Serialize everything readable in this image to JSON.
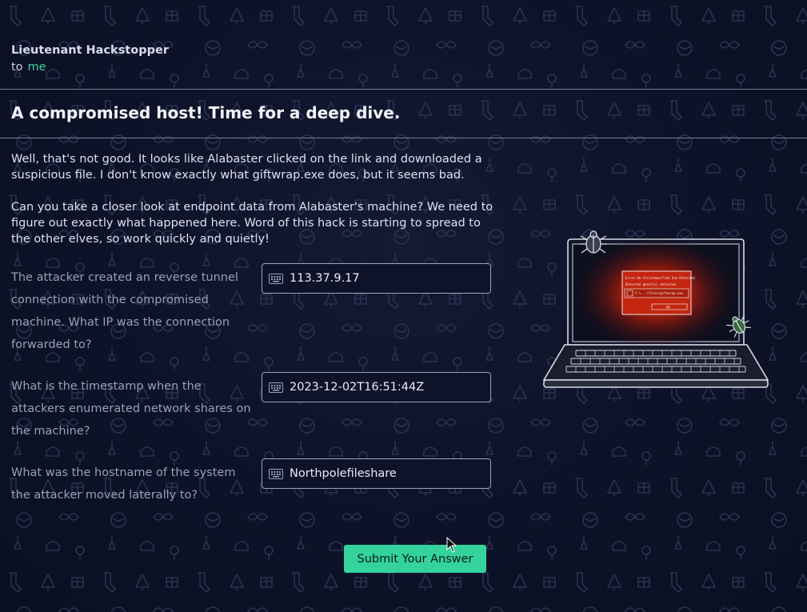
{
  "message": {
    "sender": "Lieutenant Hackstopper",
    "recipient_prefix": "to",
    "recipient": "me",
    "subject": "A compromised host! Time for a deep dive.",
    "paragraph_1": "Well, that's not good. It looks like Alabaster clicked on the link and downloaded a suspicious file. I don't know exactly what giftwrap.exe does, but it seems bad.",
    "paragraph_2": "Can you take a closer look at endpoint data from Alabaster's machine? We need to figure out exactly what happened here. Word of this hack is starting to spread to the other elves, so work quickly and quietly!"
  },
  "questions": [
    {
      "text": "The attacker created an reverse tunnel connection with the compromised machine. What IP was the connection forwarded to?",
      "answer": "113.37.9.17"
    },
    {
      "text": "What is the timestamp when the attackers enumerated network shares on the machine?",
      "answer": "2023-12-02T16:51:44Z"
    },
    {
      "text": "What was the hostname of the system the attacker moved laterally to?",
      "answer": "Northpolefileshare"
    }
  ],
  "submit_label": "Submit Your Answer",
  "illustration": {
    "dialog_line_1": "Error:Un-Christmasified Exe Detected",
    "dialog_line_2": "Detected ghost(s) detected",
    "dialog_path": "C:\\...\\files\\giftwrap.exe",
    "dialog_ok": "OK"
  },
  "colors": {
    "accent": "#34d39e",
    "background": "#0d1228",
    "glow": "#c0230f"
  },
  "icons": [
    "keyboard-icon",
    "bug-icon",
    "mouse-cursor-icon"
  ]
}
